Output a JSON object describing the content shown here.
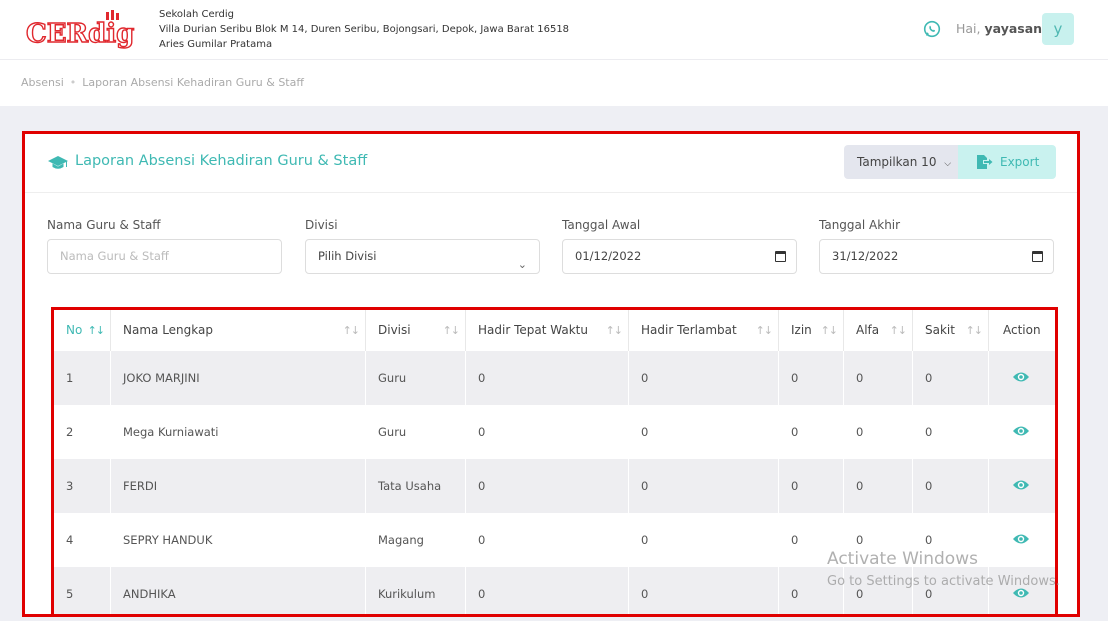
{
  "header": {
    "logo_text": "CERdig",
    "school_name": "Sekolah Cerdig",
    "address": "Villa Durian Seribu Blok M 14, Duren Seribu, Bojongsari, Depok, Jawa Barat 16518",
    "principal": "Aries Gumilar Pratama",
    "greeting_prefix": "Hai,",
    "username": "yayasan",
    "avatar_letter": "y"
  },
  "breadcrumb": {
    "parent": "Absensi",
    "current": "Laporan Absensi Kehadiran Guru & Staff"
  },
  "card": {
    "title": "Laporan Absensi Kehadiran Guru & Staff",
    "show_label": "Tampilkan 10",
    "export_label": "Export"
  },
  "filters": {
    "name_label": "Nama Guru & Staff",
    "name_placeholder": "Nama Guru & Staff",
    "division_label": "Divisi",
    "division_value": "Pilih Divisi",
    "start_label": "Tanggal Awal",
    "start_value": "01/12/2022",
    "end_label": "Tanggal Akhir",
    "end_value": "31/12/2022"
  },
  "table": {
    "columns": [
      "No",
      "Nama Lengkap",
      "Divisi",
      "Hadir Tepat Waktu",
      "Hadir Terlambat",
      "Izin",
      "Alfa",
      "Sakit",
      "Action"
    ],
    "rows": [
      [
        "1",
        "JOKO MARJINI",
        "Guru",
        "0",
        "0",
        "0",
        "0",
        "0"
      ],
      [
        "2",
        "Mega Kurniawati",
        "Guru",
        "0",
        "0",
        "0",
        "0",
        "0"
      ],
      [
        "3",
        "FERDI",
        "Tata Usaha",
        "0",
        "0",
        "0",
        "0",
        "0"
      ],
      [
        "4",
        "SEPRY HANDUK",
        "Magang",
        "0",
        "0",
        "0",
        "0",
        "0"
      ],
      [
        "5",
        "ANDHIKA",
        "Kurikulum",
        "0",
        "0",
        "0",
        "0",
        "0"
      ]
    ]
  },
  "watermark": {
    "line1": "Activate Windows",
    "line2": "Go to Settings to activate Windows."
  },
  "colors": {
    "accent": "#3fb9b3",
    "brand_red": "#e0282e",
    "highlight_border": "#e00000"
  }
}
